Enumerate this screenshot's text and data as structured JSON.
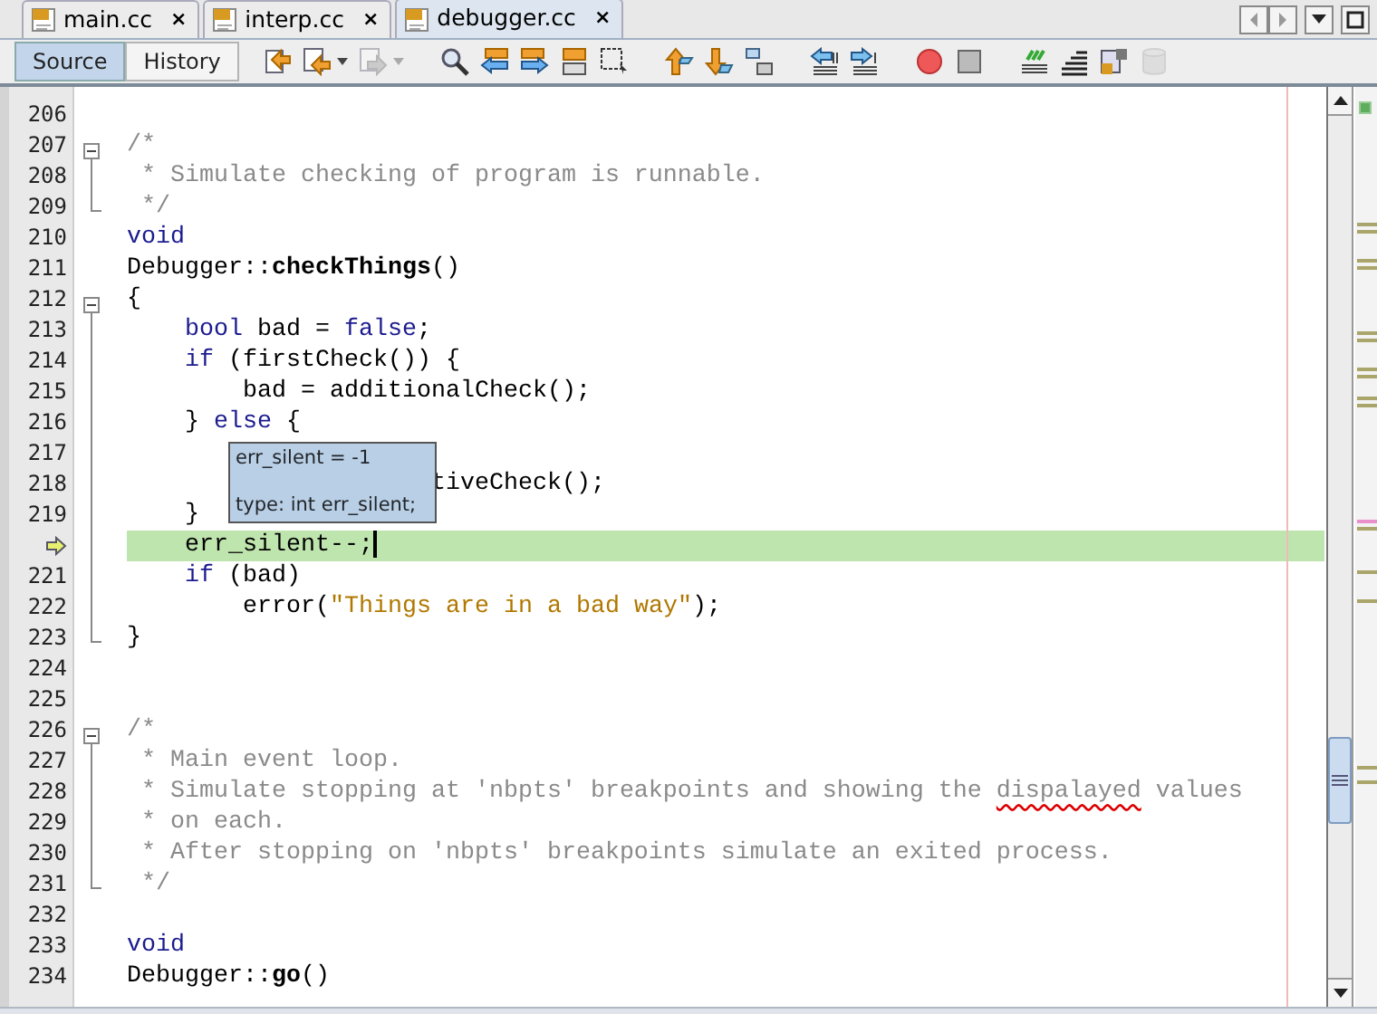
{
  "tabs": [
    {
      "label": "main.cc",
      "selected": false,
      "close": "×"
    },
    {
      "label": "interp.cc",
      "selected": false,
      "close": "×"
    },
    {
      "label": "debugger.cc",
      "selected": true,
      "close": "×"
    }
  ],
  "view_toggle": [
    {
      "label": "Source",
      "selected": true
    },
    {
      "label": "History",
      "selected": false
    }
  ],
  "toolbar": [
    {
      "kind": "last-edit",
      "disabled": false,
      "dropdown": false
    },
    {
      "kind": "prev-edit",
      "disabled": false,
      "dropdown": true
    },
    {
      "kind": "next-edit",
      "disabled": true,
      "dropdown": true
    },
    {
      "kind": "separator"
    },
    {
      "kind": "find",
      "disabled": false,
      "dropdown": false
    },
    {
      "kind": "find-prev",
      "disabled": false,
      "dropdown": false
    },
    {
      "kind": "find-next",
      "disabled": false,
      "dropdown": false
    },
    {
      "kind": "highlight",
      "disabled": false,
      "dropdown": false
    },
    {
      "kind": "rect-select",
      "disabled": false,
      "dropdown": false
    },
    {
      "kind": "separator"
    },
    {
      "kind": "prev-bookmark",
      "disabled": false,
      "dropdown": false
    },
    {
      "kind": "next-bookmark",
      "disabled": false,
      "dropdown": false
    },
    {
      "kind": "toggle-bookmark",
      "disabled": false,
      "dropdown": false
    },
    {
      "kind": "separator"
    },
    {
      "kind": "shift-left",
      "disabled": false,
      "dropdown": false
    },
    {
      "kind": "shift-right",
      "disabled": false,
      "dropdown": false
    },
    {
      "kind": "separator"
    },
    {
      "kind": "record",
      "disabled": false,
      "dropdown": false
    },
    {
      "kind": "stop",
      "disabled": false,
      "dropdown": false
    },
    {
      "kind": "separator"
    },
    {
      "kind": "comment",
      "disabled": false,
      "dropdown": false
    },
    {
      "kind": "uncomment",
      "disabled": false,
      "dropdown": false
    },
    {
      "kind": "header-source",
      "disabled": false,
      "dropdown": false
    },
    {
      "kind": "database",
      "disabled": true,
      "dropdown": false
    }
  ],
  "editor": {
    "lines": [
      {
        "number": "206",
        "current": false,
        "kind": "plain"
      },
      {
        "number": "207",
        "current": false,
        "kind": "fold-start",
        "tokens": [
          {
            "kind": "comment",
            "text": "/*"
          }
        ]
      },
      {
        "number": "208",
        "current": false,
        "kind": "fold-inside",
        "tokens": [
          {
            "kind": "comment",
            "text": " * Simulate checking of program is runnable."
          }
        ]
      },
      {
        "number": "209",
        "current": false,
        "kind": "fold-end",
        "tokens": [
          {
            "kind": "comment",
            "text": " */"
          }
        ]
      },
      {
        "number": "210",
        "current": false,
        "kind": "plain",
        "tokens": [
          {
            "kind": "keyword",
            "text": "void"
          }
        ]
      },
      {
        "number": "211",
        "current": false,
        "kind": "plain",
        "tokens": [
          {
            "kind": "plain",
            "text": "Debugger::"
          },
          {
            "kind": "bold",
            "text": "checkThings"
          },
          {
            "kind": "plain",
            "text": "()"
          }
        ]
      },
      {
        "number": "212",
        "current": false,
        "kind": "fold-start",
        "tokens": [
          {
            "kind": "plain",
            "text": "{"
          }
        ]
      },
      {
        "number": "213",
        "current": false,
        "kind": "fold-inside",
        "tokens": [
          {
            "kind": "keyword",
            "text": "    bool"
          },
          {
            "kind": "plain",
            "text": " bad = "
          },
          {
            "kind": "keyword",
            "text": "false"
          },
          {
            "kind": "plain",
            "text": ";"
          }
        ]
      },
      {
        "number": "214",
        "current": false,
        "kind": "fold-inside",
        "tokens": [
          {
            "kind": "keyword",
            "text": "    if"
          },
          {
            "kind": "plain",
            "text": " (firstCheck()) {"
          }
        ]
      },
      {
        "number": "215",
        "current": false,
        "kind": "fold-inside",
        "tokens": [
          {
            "kind": "plain",
            "text": "        bad = additionalCheck();"
          }
        ]
      },
      {
        "number": "216",
        "current": false,
        "kind": "fold-inside",
        "tokens": [
          {
            "kind": "plain",
            "text": "    } "
          },
          {
            "kind": "keyword",
            "text": "else"
          },
          {
            "kind": "plain",
            "text": " {"
          }
        ]
      },
      {
        "number": "217",
        "current": false,
        "kind": "fold-inside"
      },
      {
        "number": "218",
        "current": false,
        "kind": "fold-inside",
        "tokens": [
          {
            "kind": "plain",
            "text": "                     tiveCheck();"
          }
        ]
      },
      {
        "number": "219",
        "current": false,
        "kind": "fold-inside",
        "tokens": [
          {
            "kind": "plain",
            "text": "    }"
          }
        ]
      },
      {
        "current": true,
        "kind": "fold-inside",
        "tokens": [
          {
            "kind": "plain",
            "text": "    err_silent--;"
          }
        ]
      },
      {
        "number": "221",
        "current": false,
        "kind": "fold-inside",
        "tokens": [
          {
            "kind": "keyword",
            "text": "    if"
          },
          {
            "kind": "plain",
            "text": " (bad)"
          }
        ]
      },
      {
        "number": "222",
        "current": false,
        "kind": "fold-inside",
        "tokens": [
          {
            "kind": "plain",
            "text": "        error("
          },
          {
            "kind": "string",
            "text": "\"Things are in a bad way\""
          },
          {
            "kind": "plain",
            "text": ");"
          }
        ]
      },
      {
        "number": "223",
        "current": false,
        "kind": "fold-end",
        "tokens": [
          {
            "kind": "plain",
            "text": "}"
          }
        ]
      },
      {
        "number": "224",
        "current": false,
        "kind": "plain"
      },
      {
        "number": "225",
        "current": false,
        "kind": "plain"
      },
      {
        "number": "226",
        "current": false,
        "kind": "fold-start",
        "tokens": [
          {
            "kind": "comment",
            "text": "/*"
          }
        ]
      },
      {
        "number": "227",
        "current": false,
        "kind": "fold-inside",
        "tokens": [
          {
            "kind": "comment",
            "text": " * Main event loop."
          }
        ]
      },
      {
        "number": "228",
        "current": false,
        "kind": "fold-inside",
        "tokens": [
          {
            "kind": "comment",
            "text": " * Simulate stopping at 'nbpts' breakpoints and showing the "
          },
          {
            "kind": "misspelled",
            "text": "dispalayed"
          },
          {
            "kind": "comment",
            "text": " values"
          }
        ]
      },
      {
        "number": "229",
        "current": false,
        "kind": "fold-inside",
        "tokens": [
          {
            "kind": "comment",
            "text": " * on each."
          }
        ]
      },
      {
        "number": "230",
        "current": false,
        "kind": "fold-inside",
        "tokens": [
          {
            "kind": "comment",
            "text": " * After stopping on 'nbpts' breakpoints simulate an exited process."
          }
        ]
      },
      {
        "number": "231",
        "current": false,
        "kind": "fold-end",
        "tokens": [
          {
            "kind": "comment",
            "text": " */"
          }
        ]
      },
      {
        "number": "232",
        "current": false,
        "kind": "plain"
      },
      {
        "number": "233",
        "current": false,
        "kind": "plain",
        "tokens": [
          {
            "kind": "keyword",
            "text": "void"
          }
        ]
      },
      {
        "number": "234",
        "current": false,
        "kind": "plain",
        "tokens": [
          {
            "kind": "plain",
            "text": "Debugger::"
          },
          {
            "kind": "bold",
            "text": "go"
          },
          {
            "kind": "plain",
            "text": "()"
          }
        ]
      }
    ]
  },
  "tooltip": {
    "value": "err_silent = -1",
    "type": "type: int err_silent;"
  }
}
